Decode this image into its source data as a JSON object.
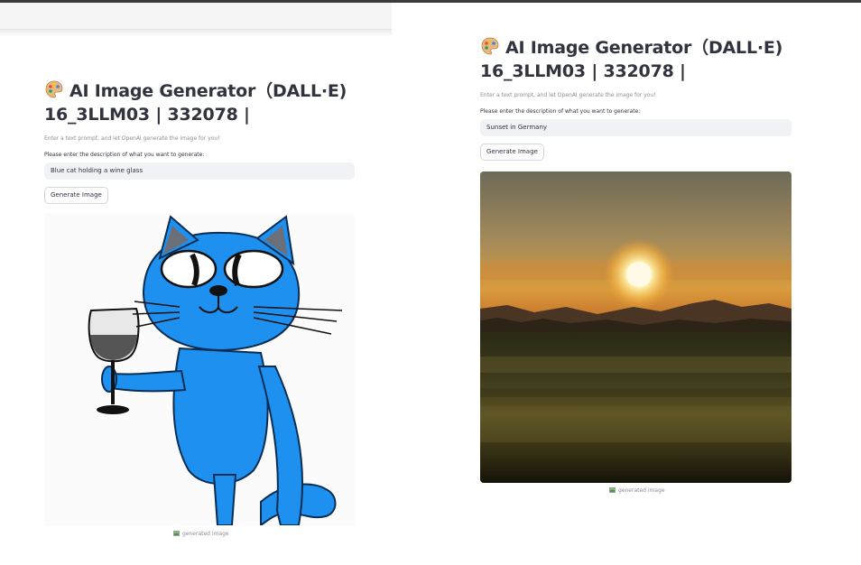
{
  "screens": [
    {
      "title_line1": "AI Image Generator（DALL·E)",
      "title_line2": "16_3LLM03 | 332078 |",
      "description": "Enter a text prompt, and let OpenAI generate the image for you!",
      "input_label": "Please enter the description of what you want to generate:",
      "input_value": "Blue cat holding a wine glass",
      "button_label": "Generate Image",
      "image_caption": "generated image"
    },
    {
      "title_line1": "AI Image Generator（DALL·E)",
      "title_line2": "16_3LLM03 | 332078 |",
      "description": "Enter a text prompt, and let OpenAI generate the image for you!",
      "input_label": "Please enter the description of what you want to generate:",
      "input_value": "Sunset in Germany",
      "button_label": "Generate Image",
      "image_caption": "generated image"
    }
  ],
  "icons": {
    "title_icon": "artist-palette-icon",
    "caption_icon": "image-icon"
  },
  "colors": {
    "input_bg": "#f0f2f6",
    "text": "#31333f",
    "muted": "#8b8d97",
    "cat_blue": "#1e90f0"
  }
}
